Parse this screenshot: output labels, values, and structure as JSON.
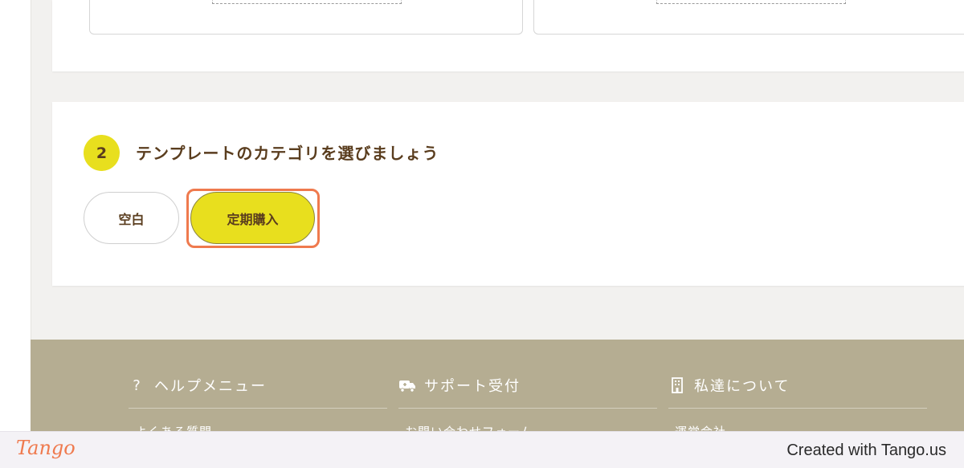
{
  "step": {
    "number": "2",
    "title": "テンプレートのカテゴリを選びましょう",
    "categories": [
      {
        "label": "空白",
        "selected": false
      },
      {
        "label": "定期購入",
        "selected": true
      }
    ]
  },
  "footer": {
    "columns": [
      {
        "icon": "question-icon",
        "title": "ヘルプメニュー",
        "link": "よくある質問"
      },
      {
        "icon": "support-truck-icon",
        "title": "サポート受付",
        "link": "お問い合わせフォーム"
      },
      {
        "icon": "building-icon",
        "title": "私達について",
        "link": "運営会社"
      }
    ]
  },
  "tango": {
    "logo": "Tango",
    "credit": "Created with Tango.us"
  },
  "colors": {
    "accent_yellow": "#e8df1e",
    "heading_brown": "#5a3d1e",
    "footer_bg": "#b5ad92",
    "highlight": "#ef7a4e"
  }
}
